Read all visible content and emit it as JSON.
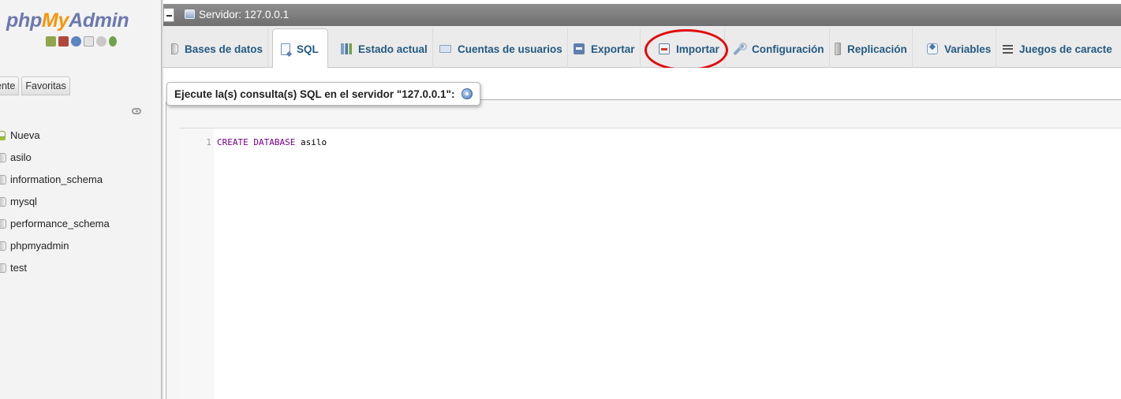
{
  "navigation": {
    "logo": {
      "part1": "php",
      "part2": "My",
      "part3": "Admin"
    },
    "logo_icons": [
      "home-icon",
      "database-icon",
      "info-icon",
      "document-icon",
      "settings-icon",
      "reload-icon"
    ],
    "tabs": [
      {
        "label": "ciente"
      },
      {
        "label": "Favoritas"
      }
    ],
    "tree": [
      {
        "label": "Nueva",
        "icon": "new-database-icon"
      },
      {
        "label": "asilo",
        "icon": "database-icon"
      },
      {
        "label": "information_schema",
        "icon": "database-icon"
      },
      {
        "label": "mysql",
        "icon": "database-icon"
      },
      {
        "label": "performance_schema",
        "icon": "database-icon"
      },
      {
        "label": "phpmyadmin",
        "icon": "database-icon"
      },
      {
        "label": "test",
        "icon": "database-icon"
      }
    ]
  },
  "server_bar": {
    "label": "Servidor: 127.0.0.1"
  },
  "tabs": [
    {
      "label": "Bases de datos",
      "icon": "database-icon",
      "active": false
    },
    {
      "label": "SQL",
      "icon": "sql-icon",
      "active": true
    },
    {
      "label": "Estado actual",
      "icon": "status-chart-icon",
      "active": false
    },
    {
      "label": "Cuentas de usuarios",
      "icon": "users-icon",
      "active": false
    },
    {
      "label": "Exportar",
      "icon": "export-icon",
      "active": false
    },
    {
      "label": "Importar",
      "icon": "import-icon",
      "active": false
    },
    {
      "label": "Configuración",
      "icon": "wrench-icon",
      "active": false
    },
    {
      "label": "Replicación",
      "icon": "replication-icon",
      "active": false
    },
    {
      "label": "Variables",
      "icon": "variables-icon",
      "active": false
    },
    {
      "label": "Juegos de caracte",
      "icon": "charset-icon",
      "active": false
    }
  ],
  "sql_panel": {
    "legend": "Ejecute la(s) consulta(s) SQL en el servidor \"127.0.0.1\":",
    "help_icon": "help-icon",
    "line_number": "1",
    "code": {
      "keyword1": "CREATE",
      "keyword2": "DATABASE",
      "identifier": "asilo"
    }
  },
  "colors": {
    "logo_php": "#6c78af",
    "logo_my": "#f89406",
    "tab_text": "#235a81",
    "annotation_circle": "#e10b0b",
    "sql_keyword": "#770088"
  }
}
